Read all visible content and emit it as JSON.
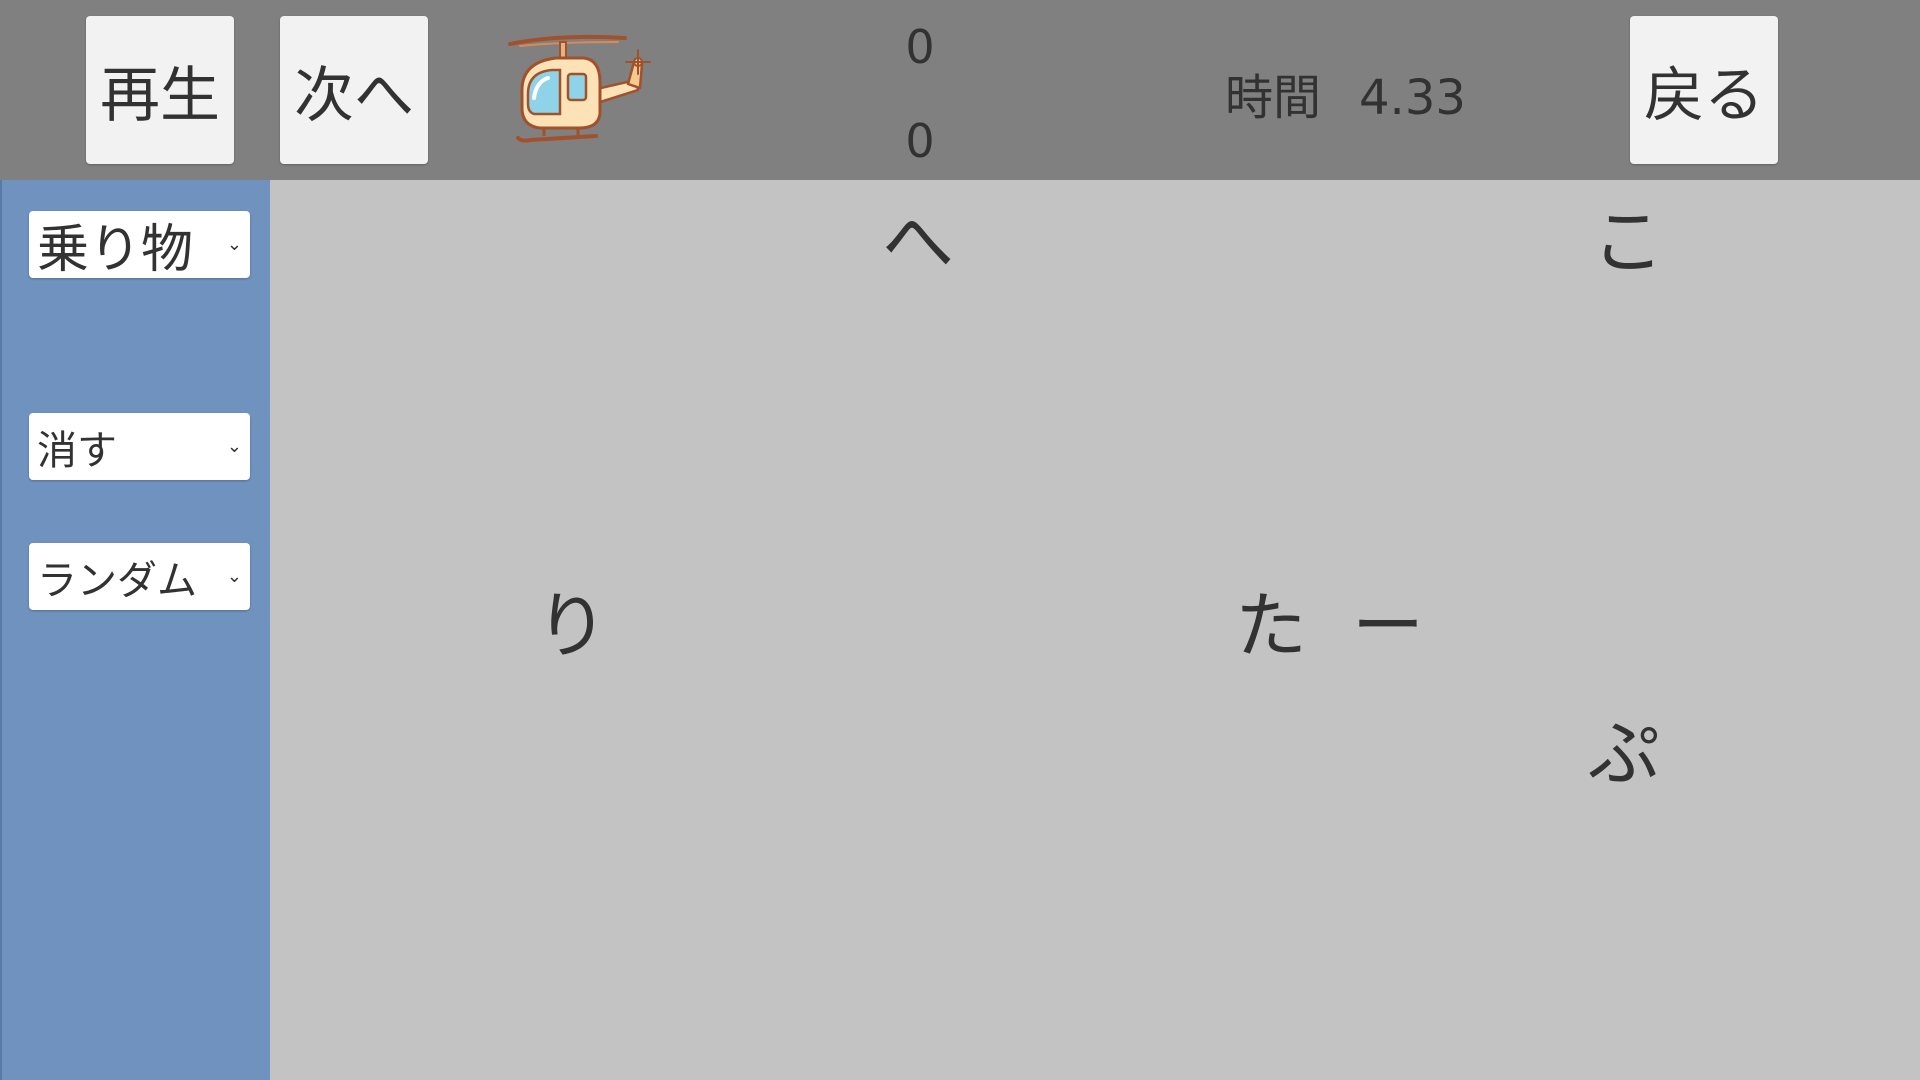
{
  "topbar": {
    "play_label": "再生",
    "next_label": "次へ",
    "counter_top": "0",
    "counter_bottom": "0",
    "time_label": "時間",
    "time_value": "4.33",
    "back_label": "戻る"
  },
  "sidebar": {
    "category": "乗り物",
    "mode": "消す",
    "order": "ランダム"
  },
  "board": {
    "tiles": [
      "へ",
      "こ",
      "り",
      "た",
      "ー",
      "ぷ"
    ]
  },
  "colors": {
    "topbar": "#808080",
    "sidebar": "#7092be",
    "board": "#c3c3c3",
    "button": "#f2f2f2",
    "text": "#323232"
  },
  "icons": {
    "preview": "helicopter-icon",
    "dropdown": "chevron-down-icon"
  }
}
